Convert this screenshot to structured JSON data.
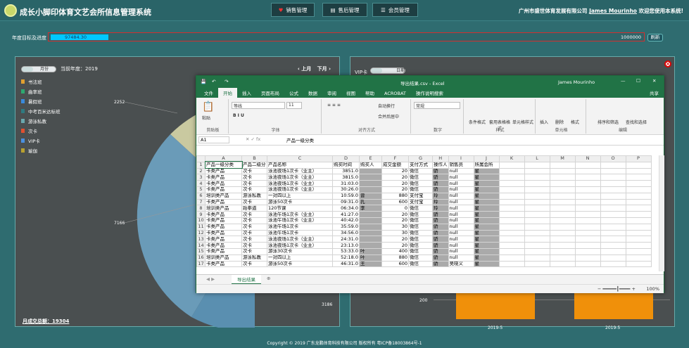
{
  "header": {
    "system_title": "成长小脚印体育文艺会所信息管理系统",
    "nav": [
      {
        "label": "销售管理"
      },
      {
        "label": "售后管理"
      },
      {
        "label": "会员管理"
      }
    ],
    "company": "广州市盛世体育发展有限公司",
    "user": "James Mourinho",
    "welcome": "欢迎您使用本系统!"
  },
  "target": {
    "label": "年度目标及进度",
    "value": "97484.30",
    "max": "1000000",
    "progress_fraction": 0.0975,
    "refresh_label": "刷新"
  },
  "left_panel": {
    "toggle_label": "月份",
    "current_year": "当前年度：2019",
    "prev": "上月",
    "next": "下月",
    "legend": [
      {
        "label": "书法班",
        "color": "#e0a030"
      },
      {
        "label": "曲率班",
        "color": "#2ea870"
      },
      {
        "label": "暑假班",
        "color": "#3a8adb"
      },
      {
        "label": "中考百米达标班",
        "color": "#2f7a80"
      },
      {
        "label": "游泳私教",
        "color": "#6aa8ae"
      },
      {
        "label": "次卡",
        "color": "#e05030"
      },
      {
        "label": "VIP卡",
        "color": "#4a90e0"
      },
      {
        "label": "瑜伽",
        "color": "#b8a030"
      }
    ],
    "pie_labels": {
      "a": "2252",
      "b": "7166",
      "c": "3186"
    },
    "total": "月成交总额：19304"
  },
  "right_panel": {
    "toggle_label": "VIP卡",
    "toggle_side": "日期",
    "y_tick": "200",
    "x_labels": [
      "2019-5",
      "2019-5"
    ]
  },
  "excel": {
    "filename": "导出结果.csv - Excel",
    "user": "James Mourinho",
    "tabs": [
      "文件",
      "开始",
      "插入",
      "页面布局",
      "公式",
      "数据",
      "审阅",
      "视图",
      "帮助",
      "ACROBAT"
    ],
    "tell_me": "操作说明搜索",
    "share": "共享",
    "font_name": "等线",
    "font_size": "11",
    "wrap": "自动换行",
    "merge": "合并后居中",
    "number_format": "常规",
    "ribbon_groups": [
      "剪贴板",
      "字体",
      "对齐方式",
      "数字",
      "样式",
      "单元格",
      "编辑"
    ],
    "style_buttons": [
      "条件格式",
      "套用表格格式",
      "单元格样式"
    ],
    "cell_buttons": [
      "插入",
      "删除",
      "格式"
    ],
    "edit_buttons": [
      "排序和筛选",
      "查找和选择"
    ],
    "paste": "粘贴",
    "cell_ref": "A1",
    "formula": "产品一级分类",
    "columns": [
      "A",
      "B",
      "C",
      "D",
      "E",
      "F",
      "G",
      "H",
      "I",
      "J",
      "K",
      "L",
      "M",
      "N",
      "O",
      "P"
    ],
    "rows": [
      [
        "产品一级分类",
        "产品二级分",
        "产品名称",
        "购买时间",
        "购买人",
        "成交金额",
        "支付方式",
        "操作人",
        "销售员",
        "所属会所"
      ],
      [
        "卡类产品",
        "次卡",
        "泳池夜场1次卡（业主）",
        "3851.0",
        "",
        "20",
        "微信",
        "骄",
        "null",
        "星"
      ],
      [
        "卡类产品",
        "次卡",
        "泳池夜场1次卡（业主）",
        "3815.0",
        "",
        "20",
        "微信",
        "骄",
        "null",
        "星"
      ],
      [
        "卡类产品",
        "次卡",
        "泳池夜场1次卡（业主）",
        "31:03.0",
        "",
        "20",
        "微信",
        "骄",
        "null",
        "星"
      ],
      [
        "卡类产品",
        "次卡",
        "泳池夜场1次卡（业主）",
        "30:26.0",
        "",
        "20",
        "微信",
        "骄",
        "null",
        "星"
      ],
      [
        "培训类产品",
        "游泳私教",
        "一对四以上",
        "10:59.0",
        "曾",
        "880",
        "支付宝",
        "玲",
        "null",
        "星"
      ],
      [
        "卡类产品",
        "次卡",
        "游泳50次卡",
        "09:31.0",
        "孔",
        "600",
        "支付宝",
        "玲",
        "null",
        "星"
      ],
      [
        "培训类产品",
        "跆拳道",
        "120节课",
        "06:34.0",
        "李",
        "0",
        "微信",
        "玲",
        "null",
        "星"
      ],
      [
        "卡类产品",
        "次卡",
        "泳池午场1次卡（业主）",
        "41:27.0",
        "",
        "20",
        "微信",
        "骄",
        "null",
        "星"
      ],
      [
        "卡类产品",
        "次卡",
        "泳池午场1次卡（业主）",
        "40:42.0",
        "",
        "20",
        "微信",
        "骄",
        "null",
        "星"
      ],
      [
        "卡类产品",
        "次卡",
        "泳池午场1次卡",
        "35:59.0",
        "",
        "30",
        "微信",
        "骄",
        "null",
        "星"
      ],
      [
        "卡类产品",
        "次卡",
        "泳池午场1次卡",
        "34:56.0",
        "",
        "30",
        "微信",
        "骄",
        "null",
        "星"
      ],
      [
        "卡类产品",
        "次卡",
        "泳池夜场1次卡（业主）",
        "24:31.0",
        "",
        "20",
        "微信",
        "骄",
        "null",
        "星"
      ],
      [
        "卡类产品",
        "次卡",
        "泳池夜场1次卡（业主）",
        "23:13.0",
        "",
        "20",
        "微信",
        "骄",
        "null",
        "星"
      ],
      [
        "卡类产品",
        "次卡",
        "游泳30次卡",
        "53:33.0",
        "叶",
        "400",
        "微信",
        "骄",
        "null",
        "星"
      ],
      [
        "培训类产品",
        "游泳私教",
        "一对四以上",
        "52:18.0",
        "叶",
        "880",
        "微信",
        "骄",
        "null",
        "星"
      ],
      [
        "卡类产品",
        "次卡",
        "游泳50次卡",
        "46:31.0",
        "王",
        "600",
        "微信",
        "骄",
        "吴晓义",
        "星"
      ]
    ],
    "sheet_tab": "导出结果",
    "zoom": "100%"
  },
  "footer": "Copyright © 2019 广东龙鹏体育科技有限公司 版权所有     粤ICP备18003864号-1"
}
